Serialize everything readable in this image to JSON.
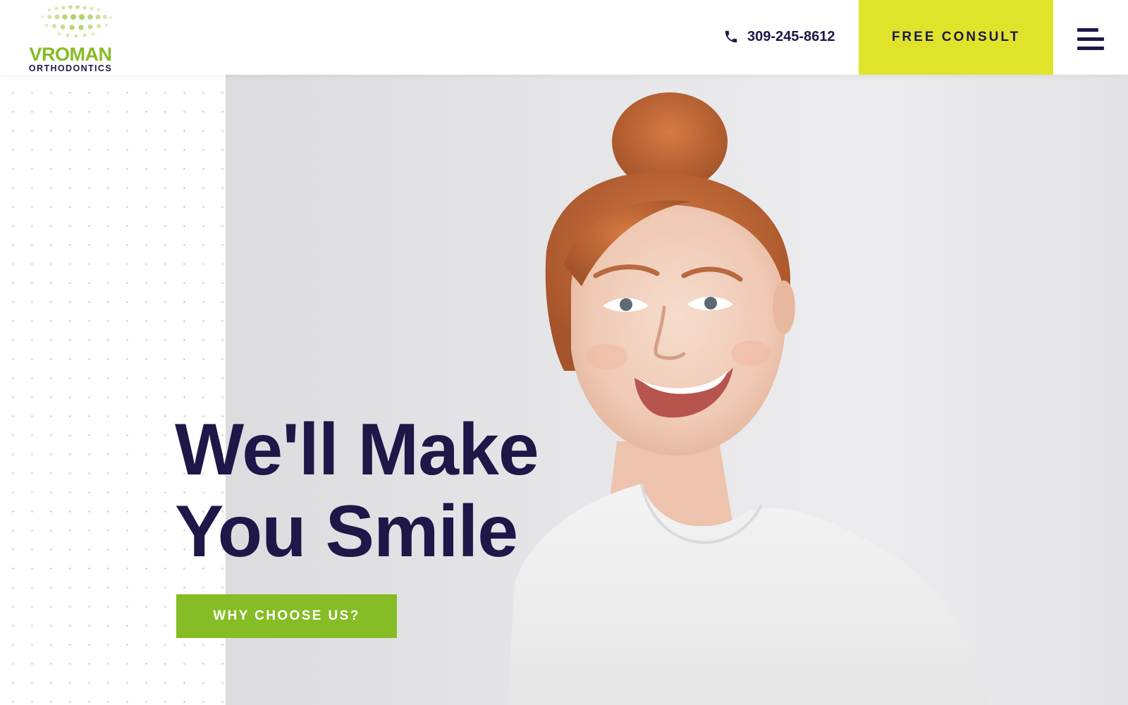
{
  "header": {
    "logo": {
      "name": "VROMAN",
      "subtitle": "ORTHODONTICS"
    },
    "phone": {
      "icon": "phone-icon",
      "number": "309-245-8612"
    },
    "cta_label": "FREE CONSULT",
    "menu_icon": "hamburger-menu-icon"
  },
  "hero": {
    "headline_line1": "We'll Make",
    "headline_line2": "You Smile",
    "button_label": "WHY CHOOSE US?",
    "image": "smiling-red-haired-woman-photo"
  },
  "colors": {
    "brand_green": "#86bc25",
    "accent_yellow": "#dfe42b",
    "navy": "#1e1748",
    "photo_background": "#e6e6e8"
  }
}
